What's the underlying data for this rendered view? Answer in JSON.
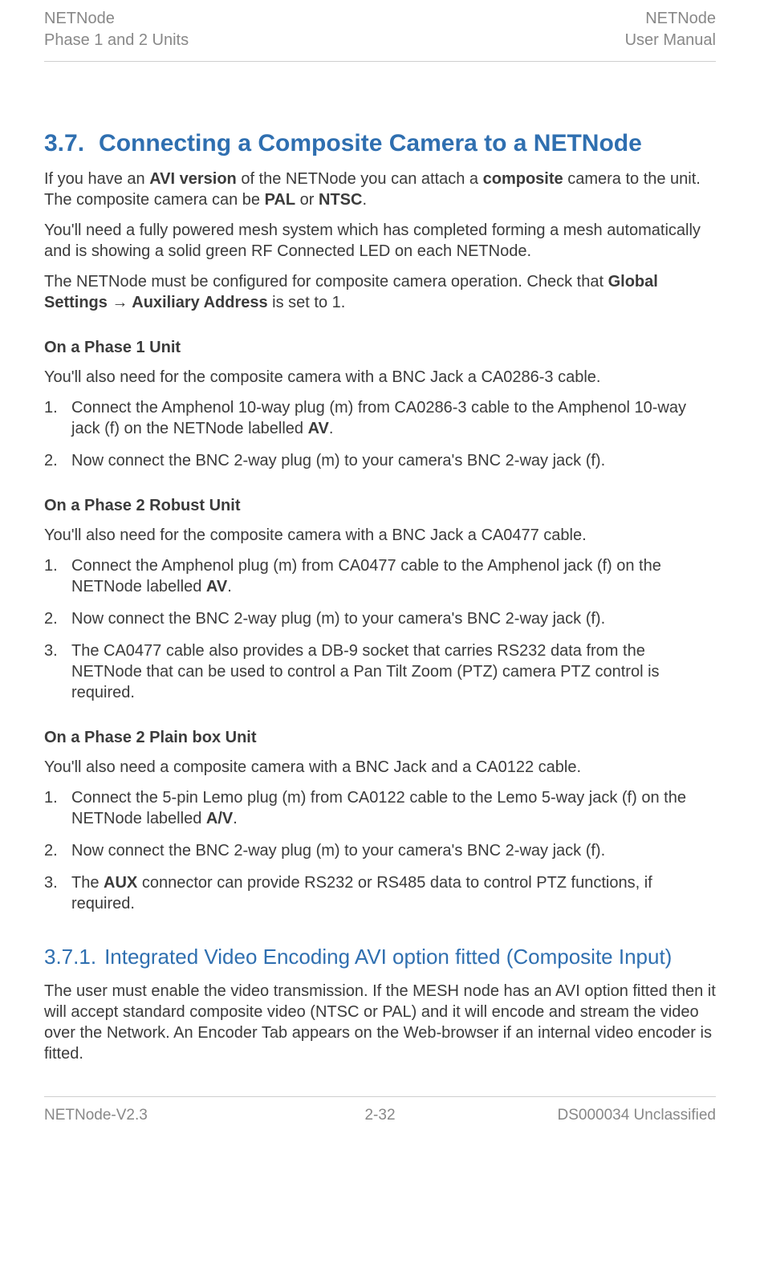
{
  "header": {
    "left_line1": "NETNode",
    "left_line2": "Phase 1 and 2 Units",
    "right_line1": "NETNode",
    "right_line2": "User Manual"
  },
  "section": {
    "number": "3.7.",
    "title": "Connecting a Composite Camera to a NETNode"
  },
  "intro": {
    "p1_a": "If you have an ",
    "p1_b": "AVI version",
    "p1_c": " of the NETNode you can attach a ",
    "p1_d": "composite",
    "p1_e": " camera to the unit. The composite camera can be ",
    "p1_f": "PAL",
    "p1_g": " or ",
    "p1_h": "NTSC",
    "p1_i": ".",
    "p2": "You'll need a fully powered mesh system which has completed forming a mesh automatically and is showing a solid green RF Connected LED on each NETNode.",
    "p3_a": "The NETNode must be configured for composite camera operation. Check that ",
    "p3_b": "Global Settings → Auxiliary Address",
    "p3_c": " is set to 1."
  },
  "phase1": {
    "heading": "On a Phase 1 Unit",
    "intro": "You'll also need for the composite camera with a BNC Jack a CA0286-3 cable.",
    "li1_a": "Connect the Amphenol 10-way plug (m) from CA0286-3 cable to the Amphenol 10-way jack (f) on the NETNode labelled ",
    "li1_b": "AV",
    "li1_c": ".",
    "li2": "Now connect the BNC 2-way plug (m) to your camera's BNC 2-way jack (f)."
  },
  "phase2robust": {
    "heading": "On a Phase 2 Robust Unit",
    "intro": "You'll also need for the composite camera with a BNC Jack a CA0477 cable.",
    "li1_a": "Connect the Amphenol plug (m) from CA0477 cable to the Amphenol jack (f) on the NETNode labelled ",
    "li1_b": "AV",
    "li1_c": ".",
    "li2": "Now connect the BNC 2-way plug (m) to your camera's BNC 2-way jack (f).",
    "li3": "The CA0477 cable also provides a DB-9 socket that carries RS232 data from the NETNode that can be used to control a Pan Tilt Zoom (PTZ) camera PTZ control is required."
  },
  "phase2plain": {
    "heading": "On a Phase 2 Plain box Unit",
    "intro": "You'll also need a composite camera with a BNC Jack and a CA0122 cable.",
    "li1_a": "Connect the 5-pin Lemo plug (m) from CA0122 cable to the Lemo 5-way jack (f) on the NETNode labelled ",
    "li1_b": "A/V",
    "li1_c": ".",
    "li2": "Now connect the BNC 2-way plug (m) to your camera's BNC 2-way jack (f).",
    "li3_a": "The ",
    "li3_b": "AUX",
    "li3_c": " connector can provide RS232 or RS485 data to control PTZ functions, if required."
  },
  "subsection": {
    "number": "3.7.1.",
    "title": "Integrated Video Encoding AVI option fitted (Composite Input)",
    "p1": "The user must enable the video transmission. If the MESH node has an AVI option fitted then it will accept standard composite video (NTSC or PAL) and it will encode and stream the video over the Network. An Encoder Tab appears on the Web-browser if an internal video encoder is fitted."
  },
  "footer": {
    "left": "NETNode-V2.3",
    "center": "2-32",
    "right": "DS000034 Unclassified"
  }
}
